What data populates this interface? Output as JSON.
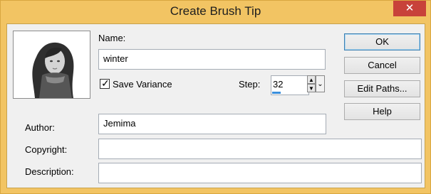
{
  "window": {
    "title": "Create Brush Tip",
    "close_label": "✕"
  },
  "form": {
    "name_label": "Name:",
    "name_value": "winter",
    "save_variance_label": "Save Variance",
    "save_variance_checked": true,
    "step_label": "Step:",
    "step_value": "32",
    "author_label": "Author:",
    "author_value": "Jemima",
    "copyright_label": "Copyright:",
    "copyright_value": "",
    "description_label": "Description:",
    "description_value": ""
  },
  "buttons": {
    "ok": "OK",
    "cancel": "Cancel",
    "edit_paths": "Edit Paths...",
    "help": "Help"
  },
  "icons": {
    "check": "✓",
    "spin_up": "▲",
    "spin_down": "▼",
    "dropdown": "⌄"
  }
}
